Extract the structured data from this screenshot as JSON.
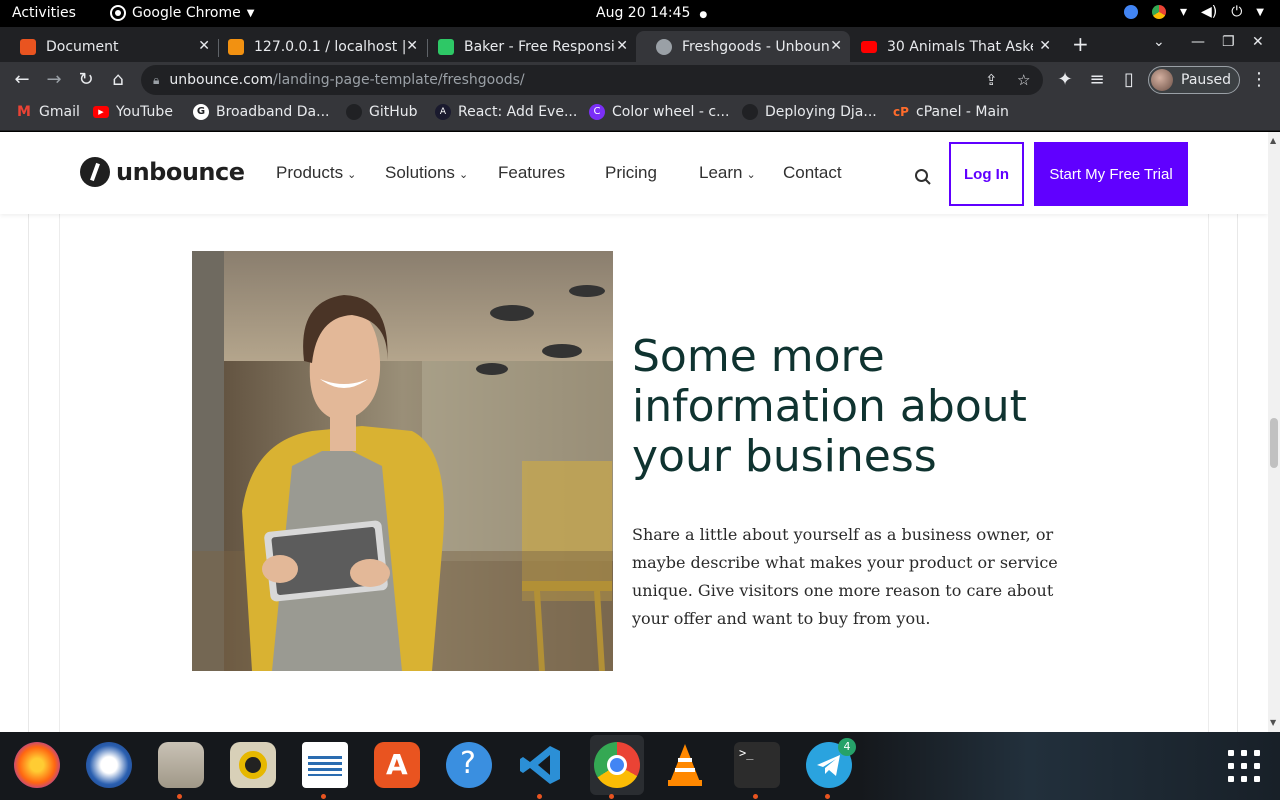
{
  "system": {
    "activities": "Activities",
    "app_name": "Google Chrome",
    "clock": "Aug 20  14:45"
  },
  "tabs": [
    {
      "title": "Document",
      "favicon_color": "#e95420",
      "active": false
    },
    {
      "title": "127.0.0.1 / localhost |",
      "favicon_color": "#f29111",
      "active": false
    },
    {
      "title": "Baker - Free Responsi",
      "favicon_color": "#2ec866",
      "active": false
    },
    {
      "title": "Freshgoods - Unboun",
      "favicon_color": "#9aa0a6",
      "active": true
    },
    {
      "title": "30 Animals That Aske",
      "favicon_color": "#ff0000",
      "active": false
    }
  ],
  "omnibox": {
    "domain": "unbounce.com",
    "path": "/landing-page-template/freshgoods/"
  },
  "profile": {
    "label": "Paused"
  },
  "bookmarks": [
    {
      "label": "Gmail",
      "color": "#ea4335"
    },
    {
      "label": "YouTube",
      "color": "#ff0000"
    },
    {
      "label": "Broadband Da...",
      "color": "#ffffff"
    },
    {
      "label": "GitHub",
      "color": "#202124"
    },
    {
      "label": "React: Add Eve...",
      "color": "#1a1a2e"
    },
    {
      "label": "Color wheel - c...",
      "color": "#7b2ff7"
    },
    {
      "label": "Deploying Dja...",
      "color": "#202124"
    },
    {
      "label": "cPanel - Main",
      "color": "#ff6c2c"
    }
  ],
  "site_nav": {
    "brand": "unbounce",
    "links": [
      "Products",
      "Solutions",
      "Features",
      "Pricing",
      "Learn",
      "Contact"
    ],
    "login": "Log In",
    "cta": "Start My Free Trial",
    "accent": "#6000ff"
  },
  "section": {
    "headline": "Some more information about your business",
    "body": "Share a little about yourself as a business owner, or maybe describe what makes your product or service unique. Give visitors one more reason to care about your offer and want to buy from you."
  },
  "dock": {
    "apps": [
      "Firefox",
      "Thunderbird",
      "Files",
      "Rhythmbox",
      "LibreOffice Writer",
      "Ubuntu Software",
      "Help",
      "Visual Studio Code",
      "Google Chrome",
      "VLC",
      "Terminal",
      "Telegram"
    ],
    "telegram_badge": "4"
  }
}
